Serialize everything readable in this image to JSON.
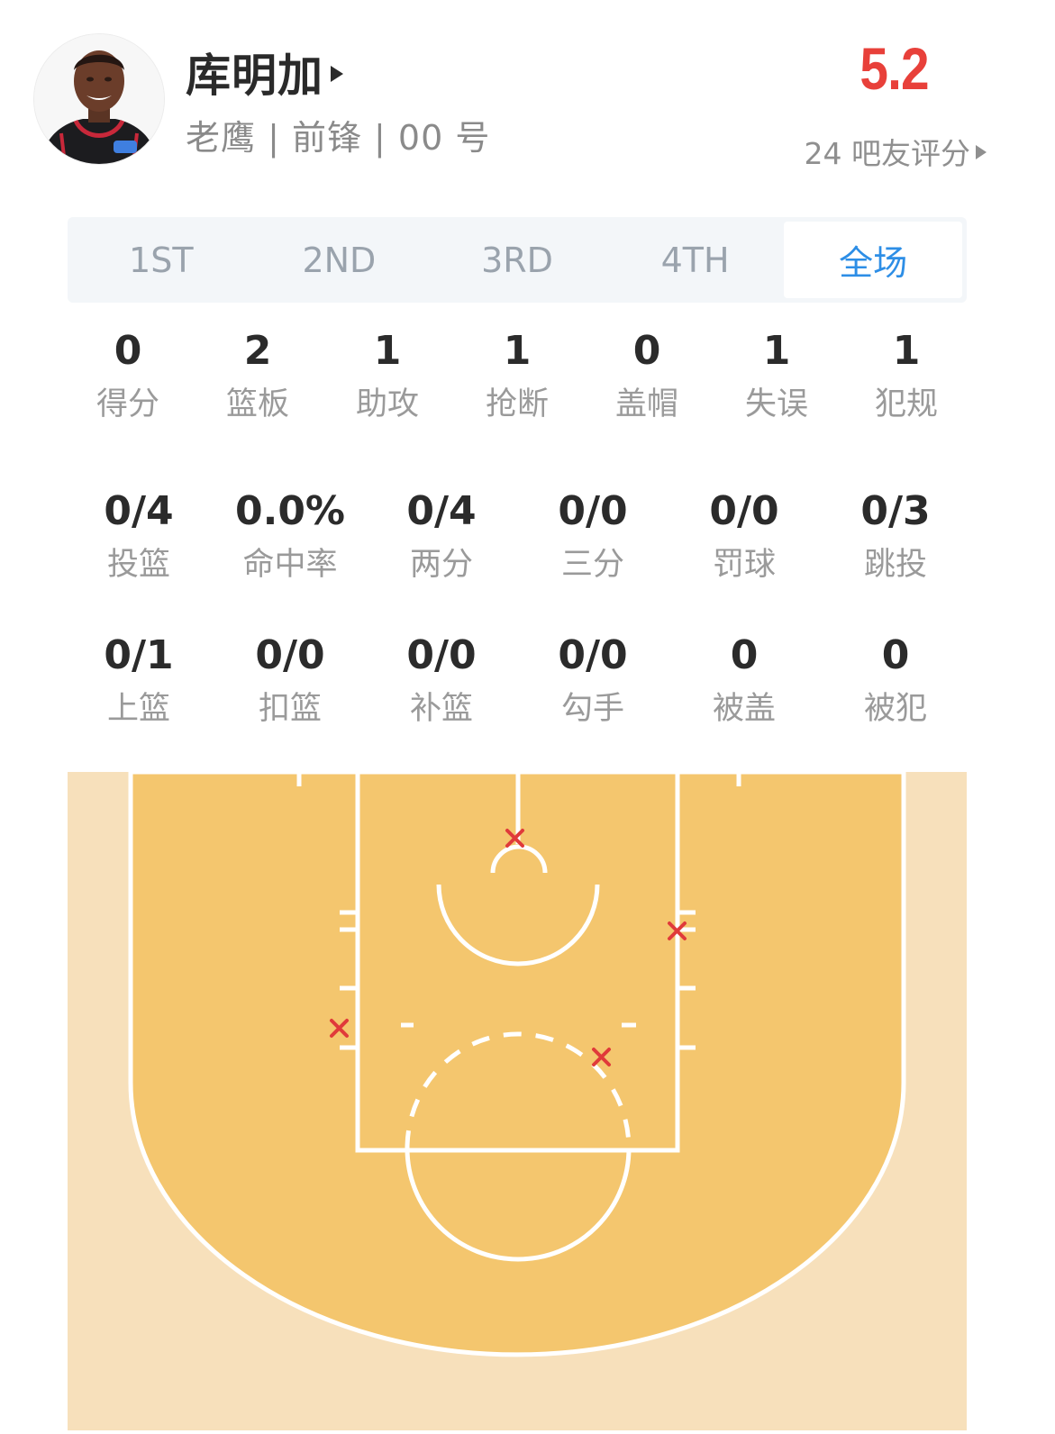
{
  "player": {
    "name": "库明加",
    "meta": "老鹰 | 前锋 | 00 号",
    "rating": "5.2",
    "rating_link": "24 吧友评分"
  },
  "tabs": [
    {
      "label": "1ST",
      "active": false
    },
    {
      "label": "2ND",
      "active": false
    },
    {
      "label": "3RD",
      "active": false
    },
    {
      "label": "4TH",
      "active": false
    },
    {
      "label": "全场",
      "active": true
    }
  ],
  "basic_stats": [
    {
      "value": "0",
      "label": "得分"
    },
    {
      "value": "2",
      "label": "篮板"
    },
    {
      "value": "1",
      "label": "助攻"
    },
    {
      "value": "1",
      "label": "抢断"
    },
    {
      "value": "0",
      "label": "盖帽"
    },
    {
      "value": "1",
      "label": "失误"
    },
    {
      "value": "1",
      "label": "犯规"
    }
  ],
  "shooting_stats": [
    {
      "value": "0/4",
      "label": "投篮"
    },
    {
      "value": "0.0%",
      "label": "命中率"
    },
    {
      "value": "0/4",
      "label": "两分"
    },
    {
      "value": "0/0",
      "label": "三分"
    },
    {
      "value": "0/0",
      "label": "罚球"
    },
    {
      "value": "0/3",
      "label": "跳投"
    }
  ],
  "shot_type_stats": [
    {
      "value": "0/1",
      "label": "上篮"
    },
    {
      "value": "0/0",
      "label": "扣篮"
    },
    {
      "value": "0/0",
      "label": "补篮"
    },
    {
      "value": "0/0",
      "label": "勾手"
    },
    {
      "value": "0",
      "label": "被盖"
    },
    {
      "value": "0",
      "label": "被犯"
    }
  ],
  "colors": {
    "accent": "#2d8ee6",
    "rating": "#e8403a",
    "court_outer": "#f7e0bb",
    "court_inner": "#f4c66e",
    "court_line": "#ffffff",
    "miss_mark": "#e03a3a"
  },
  "shot_chart": {
    "made": 0,
    "missed": 4,
    "marker": "red-x"
  }
}
